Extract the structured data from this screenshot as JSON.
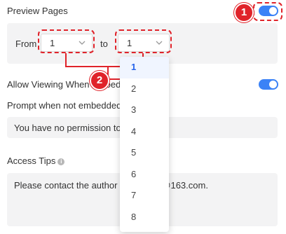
{
  "preview_pages": {
    "label": "Preview Pages",
    "toggle_on": true
  },
  "range": {
    "from_label": "From",
    "from_value": "1",
    "to_label": "to",
    "to_value": "1"
  },
  "dropdown": {
    "options": [
      "1",
      "2",
      "3",
      "4",
      "5",
      "6",
      "7",
      "8"
    ],
    "selected": "1"
  },
  "allow_viewing": {
    "label": "Allow Viewing When Embedded",
    "toggle_on": true
  },
  "prompt": {
    "label": "Prompt when not embedded",
    "value": "You have no permission to view"
  },
  "access_tips": {
    "label": "Access Tips",
    "icon": "info-icon",
    "value": "Please contact the author via xxxxxx@163.com."
  },
  "annotations": {
    "badge_1": "1",
    "badge_2": "2"
  },
  "colors": {
    "accent": "#3b82f6",
    "annotation": "#e0232a",
    "selected_option": "#2563eb"
  }
}
